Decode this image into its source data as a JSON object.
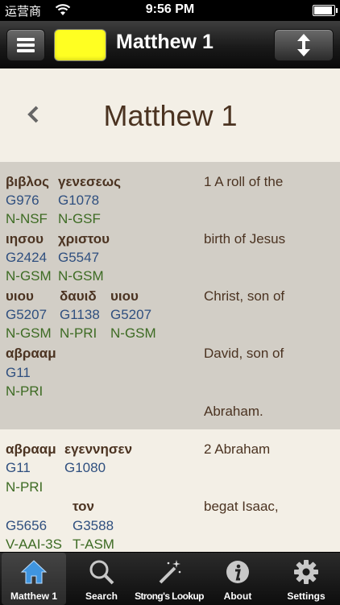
{
  "status_bar": {
    "carrier": "运营商",
    "time": "9:56 PM"
  },
  "toolbar": {
    "title": "Matthew 1"
  },
  "chapter": {
    "title": "Matthew 1"
  },
  "verses": [
    {
      "lines": [
        {
          "words": [
            "βιβλος",
            "γενεσεως"
          ],
          "strongs": [
            "G976",
            "G1078"
          ],
          "parsing": [
            "N-NSF",
            "N-GSF"
          ]
        },
        {
          "words": [
            "ιησου",
            "χριστου"
          ],
          "strongs": [
            "G2424",
            "G5547"
          ],
          "parsing": [
            "N-GSM",
            "N-GSM"
          ]
        },
        {
          "words": [
            "υιου",
            "δαυιδ",
            "υιου"
          ],
          "strongs": [
            "G5207",
            "G1138",
            "G5207"
          ],
          "parsing": [
            "N-GSM",
            "N-PRI",
            "N-GSM"
          ]
        },
        {
          "words": [
            "αβρααμ"
          ],
          "strongs": [
            "G11"
          ],
          "parsing": [
            "N-PRI"
          ]
        }
      ],
      "english": [
        "1 A roll of the",
        "birth of Jesus",
        "Christ, son of",
        "David, son of",
        "Abraham."
      ]
    },
    {
      "lines": [
        {
          "words": [
            "αβρααμ",
            "εγεννησεν"
          ],
          "strongs": [
            "G11",
            "G1080"
          ],
          "parsing": [
            "N-PRI",
            ""
          ]
        },
        {
          "words": [
            "",
            "τον"
          ],
          "strongs": [
            "G5656",
            "G3588"
          ],
          "parsing": [
            "V-AAI-3S",
            "T-ASM"
          ]
        }
      ],
      "english": [
        "2 Abraham",
        "begat Isaac,"
      ]
    }
  ],
  "tabs": [
    {
      "label": "Matthew 1",
      "icon": "home-icon",
      "active": true
    },
    {
      "label": "Search",
      "icon": "search-icon",
      "active": false
    },
    {
      "label": "Strong's Lookup",
      "icon": "magic-wand-icon",
      "active": false
    },
    {
      "label": "About",
      "icon": "info-icon",
      "active": false
    },
    {
      "label": "Settings",
      "icon": "gear-icon",
      "active": false
    }
  ],
  "colors": {
    "greek": "#4b3321",
    "strongs": "#2f4f7f",
    "parsing": "#3d6b23",
    "highlight": "#ffff22"
  },
  "battery_level": 0.9
}
